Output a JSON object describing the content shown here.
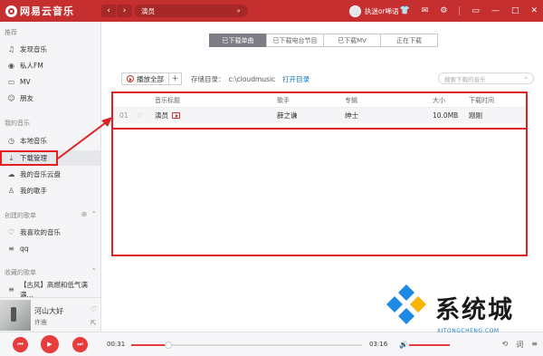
{
  "app": {
    "name": "网易云音乐",
    "search_query": "演员",
    "username": "执迷or唏语"
  },
  "topbar_icons": [
    "shirt-icon",
    "mail-icon",
    "settings-icon",
    "mini-mode-icon",
    "minimize-icon",
    "maximize-icon",
    "close-icon"
  ],
  "sidebar": {
    "sections": [
      {
        "title": "推荐",
        "items": [
          {
            "label": "发现音乐",
            "icon": "music-note-icon"
          },
          {
            "label": "私人FM",
            "icon": "radio-icon"
          },
          {
            "label": "MV",
            "icon": "video-icon"
          },
          {
            "label": "朋友",
            "icon": "friends-icon"
          }
        ]
      },
      {
        "title": "我的音乐",
        "items": [
          {
            "label": "本地音乐",
            "icon": "local-music-icon"
          },
          {
            "label": "下载管理",
            "icon": "download-icon"
          },
          {
            "label": "我的音乐云盘",
            "icon": "cloud-icon"
          },
          {
            "label": "我的歌手",
            "icon": "singer-icon"
          }
        ]
      },
      {
        "title": "创建的歌单",
        "items": [
          {
            "label": "我喜欢的音乐",
            "icon": "heart-icon"
          },
          {
            "label": "qq",
            "icon": "playlist-icon"
          }
        ]
      },
      {
        "title": "收藏的歌单",
        "items": [
          {
            "label": "【古风】高燃和低气满满...",
            "icon": "playlist-icon"
          }
        ]
      }
    ]
  },
  "tabs": [
    "已下载单曲",
    "已下载电台节目",
    "已下载MV",
    "正在下载"
  ],
  "toolbar": {
    "play_all": "播放全部",
    "add": "+",
    "storage_label": "存储目录：",
    "storage_path": "c:\\cloudmusic",
    "open_dir": "打开目录",
    "search_placeholder": "搜索下载的音乐"
  },
  "table": {
    "headers": [
      "音乐标题",
      "歌手",
      "专辑",
      "大小",
      "下载时间"
    ],
    "rows": [
      {
        "index": "01",
        "title": "演员",
        "artist": "薛之谦",
        "album": "绅士",
        "size": "10.0MB",
        "time": "刚刚"
      }
    ]
  },
  "now_playing": {
    "title": "河山大好",
    "artist": "许嵩"
  },
  "player": {
    "elapsed": "00:31",
    "duration": "03:16",
    "progress": 0.16
  },
  "watermark": {
    "text": "系统城",
    "sub": "XITONGCHENG.COM"
  },
  "colors": {
    "brand": "#c62f2f",
    "accent": "#e83c3c",
    "annotation": "#e02020"
  }
}
